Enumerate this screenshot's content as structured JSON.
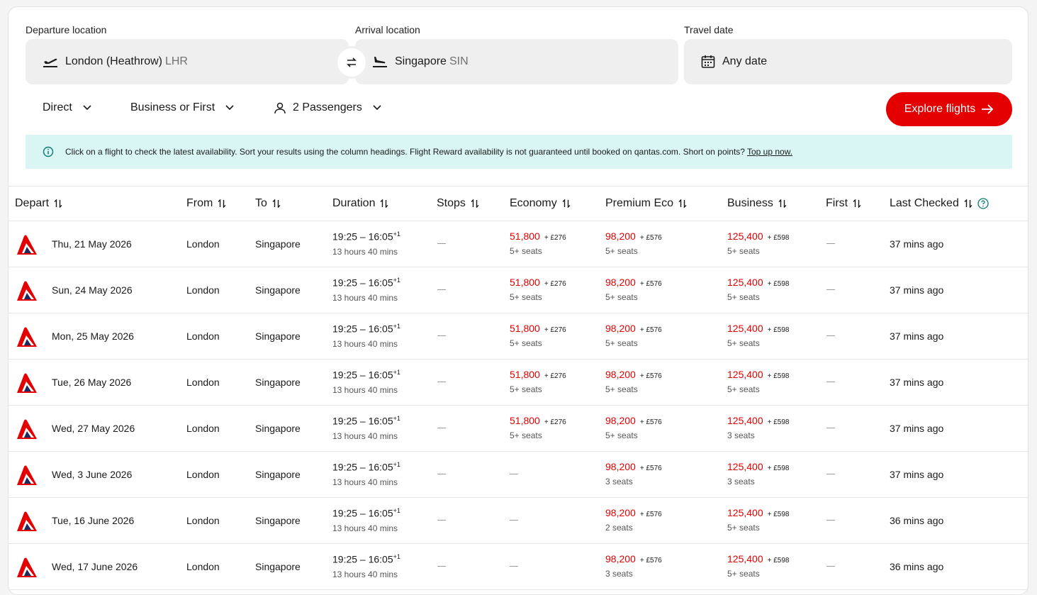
{
  "search": {
    "departure_label": "Departure location",
    "departure_city": "London (Heathrow)",
    "departure_code": "LHR",
    "arrival_label": "Arrival location",
    "arrival_city": "Singapore",
    "arrival_code": "SIN",
    "date_label": "Travel date",
    "date_value": "Any date"
  },
  "filters": {
    "stops": "Direct",
    "cabin": "Business or First",
    "passengers": "2 Passengers",
    "explore_button": "Explore flights"
  },
  "info": {
    "message": "Click on a flight to check the latest availability. Sort your results using the column headings. Flight Reward availability is not guaranteed until booked on qantas.com. Short on points?",
    "link": "Top up now."
  },
  "columns": {
    "depart": "Depart",
    "from": "From",
    "to": "To",
    "duration": "Duration",
    "stops": "Stops",
    "economy": "Economy",
    "premium": "Premium Eco",
    "business": "Business",
    "first": "First",
    "last_checked": "Last Checked"
  },
  "colors": {
    "accent": "#e40000",
    "info_bg": "#d9f6f4"
  },
  "rows": [
    {
      "date": "Thu, 21 May 2026",
      "from": "London",
      "to": "Singapore",
      "times": "19:25 – 16:05",
      "plus": "+1",
      "duration": "13 hours 40 mins",
      "stops": "—",
      "economy": {
        "points": "51,800",
        "tax": "+ £276",
        "seats": "5+ seats"
      },
      "premium": {
        "points": "98,200",
        "tax": "+ £576",
        "seats": "5+ seats"
      },
      "business": {
        "points": "125,400",
        "tax": "+ £598",
        "seats": "5+ seats"
      },
      "first": "—",
      "checked": "37 mins ago"
    },
    {
      "date": "Sun, 24 May 2026",
      "from": "London",
      "to": "Singapore",
      "times": "19:25 – 16:05",
      "plus": "+1",
      "duration": "13 hours 40 mins",
      "stops": "—",
      "economy": {
        "points": "51,800",
        "tax": "+ £276",
        "seats": "5+ seats"
      },
      "premium": {
        "points": "98,200",
        "tax": "+ £576",
        "seats": "5+ seats"
      },
      "business": {
        "points": "125,400",
        "tax": "+ £598",
        "seats": "5+ seats"
      },
      "first": "—",
      "checked": "37 mins ago"
    },
    {
      "date": "Mon, 25 May 2026",
      "from": "London",
      "to": "Singapore",
      "times": "19:25 – 16:05",
      "plus": "+1",
      "duration": "13 hours 40 mins",
      "stops": "—",
      "economy": {
        "points": "51,800",
        "tax": "+ £276",
        "seats": "5+ seats"
      },
      "premium": {
        "points": "98,200",
        "tax": "+ £576",
        "seats": "5+ seats"
      },
      "business": {
        "points": "125,400",
        "tax": "+ £598",
        "seats": "5+ seats"
      },
      "first": "—",
      "checked": "37 mins ago"
    },
    {
      "date": "Tue, 26 May 2026",
      "from": "London",
      "to": "Singapore",
      "times": "19:25 – 16:05",
      "plus": "+1",
      "duration": "13 hours 40 mins",
      "stops": "—",
      "economy": {
        "points": "51,800",
        "tax": "+ £276",
        "seats": "5+ seats"
      },
      "premium": {
        "points": "98,200",
        "tax": "+ £576",
        "seats": "5+ seats"
      },
      "business": {
        "points": "125,400",
        "tax": "+ £598",
        "seats": "5+ seats"
      },
      "first": "—",
      "checked": "37 mins ago"
    },
    {
      "date": "Wed, 27 May 2026",
      "from": "London",
      "to": "Singapore",
      "times": "19:25 – 16:05",
      "plus": "+1",
      "duration": "13 hours 40 mins",
      "stops": "—",
      "economy": {
        "points": "51,800",
        "tax": "+ £276",
        "seats": "5+ seats"
      },
      "premium": {
        "points": "98,200",
        "tax": "+ £576",
        "seats": "5+ seats"
      },
      "business": {
        "points": "125,400",
        "tax": "+ £598",
        "seats": "3 seats"
      },
      "first": "—",
      "checked": "37 mins ago"
    },
    {
      "date": "Wed, 3 June 2026",
      "from": "London",
      "to": "Singapore",
      "times": "19:25 – 16:05",
      "plus": "+1",
      "duration": "13 hours 40 mins",
      "stops": "—",
      "economy": null,
      "premium": {
        "points": "98,200",
        "tax": "+ £576",
        "seats": "3 seats"
      },
      "business": {
        "points": "125,400",
        "tax": "+ £598",
        "seats": "3 seats"
      },
      "first": "—",
      "checked": "37 mins ago"
    },
    {
      "date": "Tue, 16 June 2026",
      "from": "London",
      "to": "Singapore",
      "times": "19:25 – 16:05",
      "plus": "+1",
      "duration": "13 hours 40 mins",
      "stops": "—",
      "economy": null,
      "premium": {
        "points": "98,200",
        "tax": "+ £576",
        "seats": "2 seats"
      },
      "business": {
        "points": "125,400",
        "tax": "+ £598",
        "seats": "5+ seats"
      },
      "first": "—",
      "checked": "36 mins ago"
    },
    {
      "date": "Wed, 17 June 2026",
      "from": "London",
      "to": "Singapore",
      "times": "19:25 – 16:05",
      "plus": "+1",
      "duration": "13 hours 40 mins",
      "stops": "—",
      "economy": null,
      "premium": {
        "points": "98,200",
        "tax": "+ £576",
        "seats": "3 seats"
      },
      "business": {
        "points": "125,400",
        "tax": "+ £598",
        "seats": "5+ seats"
      },
      "first": "—",
      "checked": "36 mins ago"
    }
  ]
}
